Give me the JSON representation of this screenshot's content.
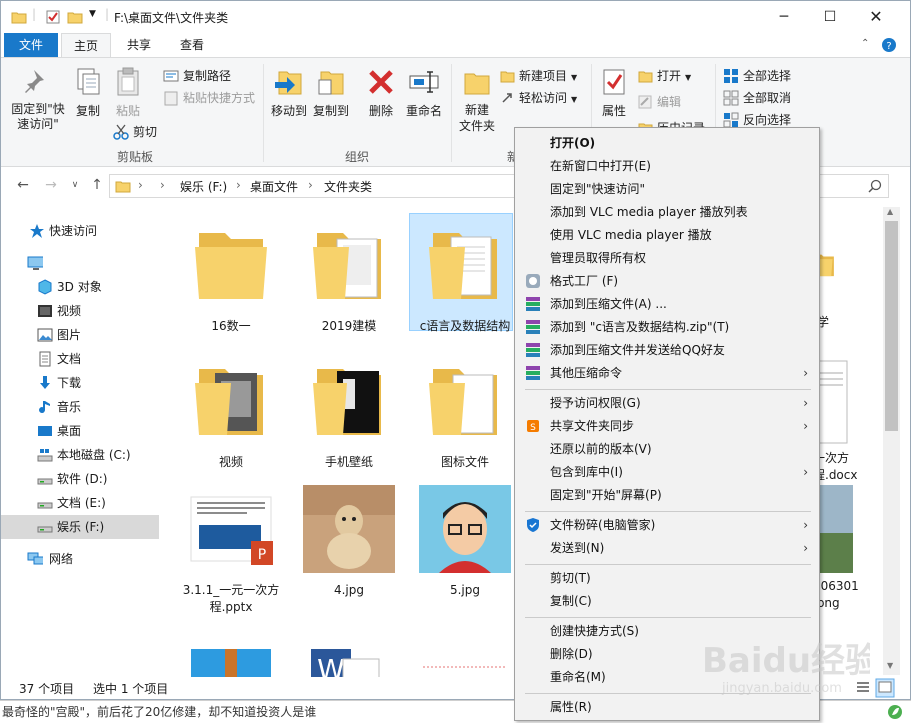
{
  "window": {
    "title": "F:\\桌面文件\\文件夹类",
    "tabs": [
      "文件",
      "主页",
      "共享",
      "查看"
    ]
  },
  "ribbon": {
    "clipboard": {
      "pin_label": "固定到\"快速访问\"",
      "copy_label": "复制",
      "paste_label": "粘贴",
      "copy_path_label": "复制路径",
      "paste_shortcut_label": "粘贴快捷方式",
      "cut_label": "剪切",
      "group_label": "剪贴板"
    },
    "organize": {
      "move_to_label": "移动到",
      "copy_to_label": "复制到",
      "delete_label": "删除",
      "rename_label": "重命名",
      "group_label": "组织"
    },
    "new": {
      "new_folder_label": "新建\n文件夹",
      "new_item_label": "新建项目",
      "easy_access_label": "轻松访问",
      "group_label": "新"
    },
    "open": {
      "properties_label": "属性",
      "open_label": "打开",
      "edit_label": "编辑",
      "history_label": "历史记录"
    },
    "select": {
      "select_all_label": "全部选择",
      "select_none_label": "全部取消",
      "invert_label": "反向选择"
    }
  },
  "address": {
    "crumbs": [
      "娱乐 (F:)",
      "桌面文件",
      "文件夹类"
    ]
  },
  "nav": {
    "items": [
      {
        "label": "快速访问"
      },
      {
        "label": ""
      },
      {
        "label": "3D 对象"
      },
      {
        "label": "视频"
      },
      {
        "label": "图片"
      },
      {
        "label": "文档"
      },
      {
        "label": "下载"
      },
      {
        "label": "音乐"
      },
      {
        "label": "桌面"
      },
      {
        "label": "本地磁盘 (C:)"
      },
      {
        "label": "软件 (D:)"
      },
      {
        "label": "文档 (E:)"
      },
      {
        "label": "娱乐 (F:)"
      },
      {
        "label": "网络"
      }
    ]
  },
  "files": [
    {
      "name": "16数一"
    },
    {
      "name": "2019建模"
    },
    {
      "name": "c语言及数据结构"
    },
    {
      "name": "视频"
    },
    {
      "name": "手机壁纸"
    },
    {
      "name": "图标文件"
    },
    {
      "name": "3.1.1_一元一次方程.pptx"
    },
    {
      "name": "4.jpg"
    },
    {
      "name": "5.jpg"
    },
    {
      "name": "学"
    },
    {
      "name": "一次方"
    },
    {
      "name": "程.docx"
    },
    {
      "name": "906301"
    },
    {
      "name": ".png"
    }
  ],
  "status": {
    "count": "37 个项目",
    "selected": "选中 1 个项目"
  },
  "bottom_strip": {
    "text": "最奇怪的\"宫殿\"，前后花了20亿修建，却不知道投资人是谁"
  },
  "context_menu": {
    "items": [
      {
        "label": "打开(O)"
      },
      {
        "label": "在新窗口中打开(E)"
      },
      {
        "label": "固定到\"快速访问\""
      },
      {
        "label": "添加到 VLC media player 播放列表"
      },
      {
        "label": "使用 VLC media player 播放"
      },
      {
        "label": "管理员取得所有权"
      },
      {
        "label": "格式工厂 (F)"
      },
      {
        "label": "添加到压缩文件(A) ..."
      },
      {
        "label": "添加到 \"c语言及数据结构.zip\"(T)"
      },
      {
        "label": "添加到压缩文件并发送给QQ好友"
      },
      {
        "label": "其他压缩命令"
      },
      {
        "label": "授予访问权限(G)"
      },
      {
        "label": "共享文件夹同步"
      },
      {
        "label": "还原以前的版本(V)"
      },
      {
        "label": "包含到库中(I)"
      },
      {
        "label": "固定到\"开始\"屏幕(P)"
      },
      {
        "label": "文件粉碎(电脑管家)"
      },
      {
        "label": "发送到(N)"
      },
      {
        "label": "剪切(T)"
      },
      {
        "label": "复制(C)"
      },
      {
        "label": "创建快捷方式(S)"
      },
      {
        "label": "删除(D)"
      },
      {
        "label": "重命名(M)"
      },
      {
        "label": "属性(R)"
      }
    ]
  },
  "watermark": {
    "text": "Baidu经验",
    "sub": "jingyan.baidu.com"
  },
  "colors": {
    "accent": "#1979ca",
    "folder": "#f7d26b",
    "selection": "#cce8ff"
  }
}
